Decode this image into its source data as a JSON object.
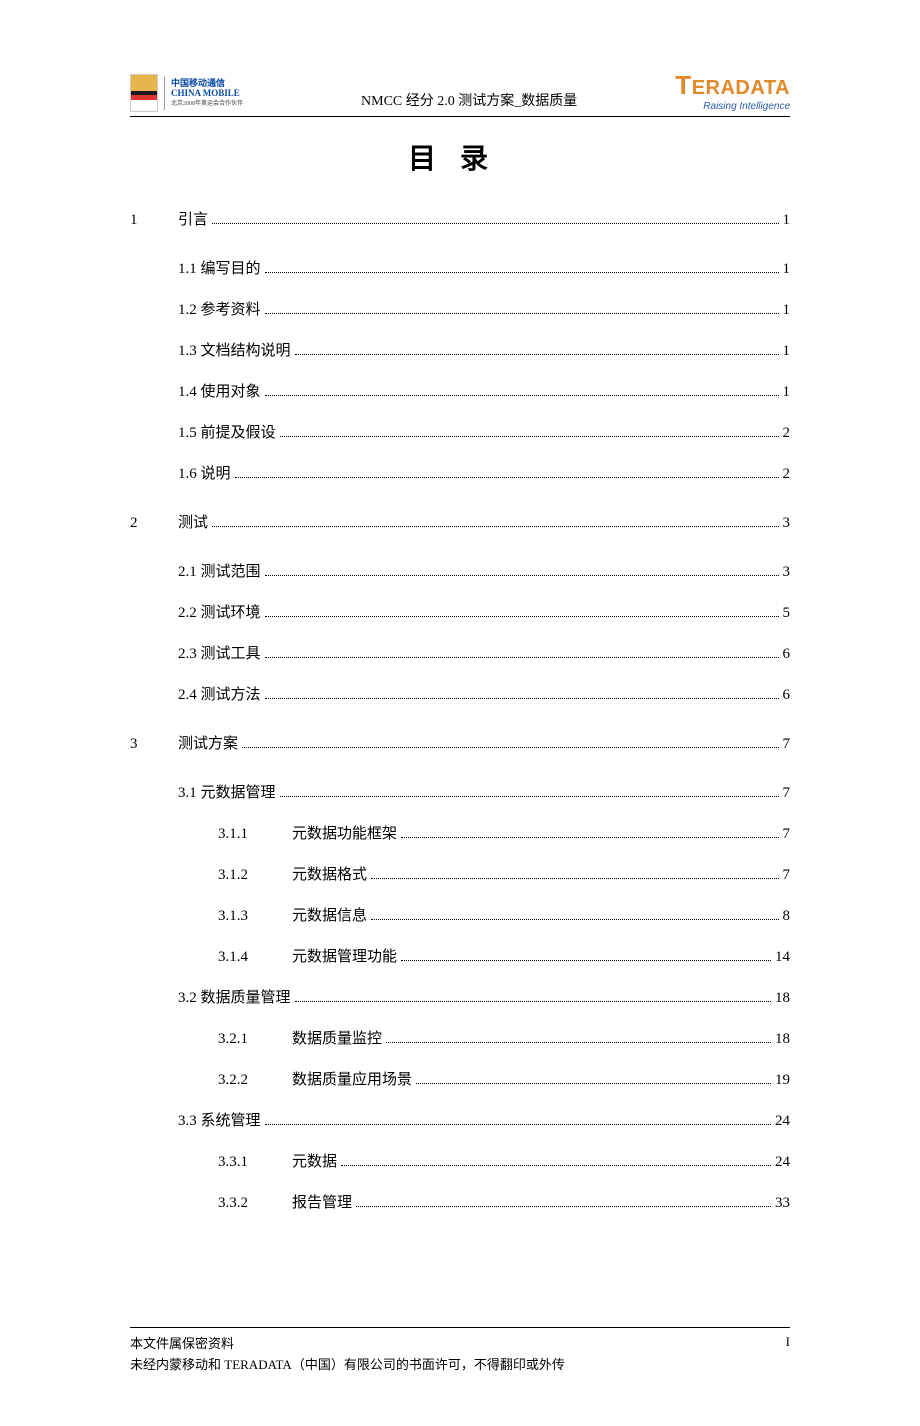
{
  "header": {
    "cmcc_cn": "中国移动通信",
    "cmcc_en": "CHINA MOBILE",
    "cmcc_sub": "北京2008年奥运会合作伙伴",
    "title": "NMCC 经分 2.0 测试方案_数据质量",
    "teradata": "ERADATA",
    "teradata_tag": "Raising Intelligence"
  },
  "toc_title": "目录",
  "toc": [
    {
      "level": 1,
      "num": "1",
      "label": "引言",
      "page": "1"
    },
    {
      "level": 2,
      "num": "1.1",
      "label": "编写目的",
      "page": "1"
    },
    {
      "level": 2,
      "num": "1.2",
      "label": "参考资料",
      "page": "1"
    },
    {
      "level": 2,
      "num": "1.3",
      "label": "文档结构说明",
      "page": "1"
    },
    {
      "level": 2,
      "num": "1.4",
      "label": "使用对象",
      "page": "1"
    },
    {
      "level": 2,
      "num": "1.5",
      "label": "前提及假设",
      "page": "2"
    },
    {
      "level": 2,
      "num": "1.6",
      "label": "说明",
      "page": "2"
    },
    {
      "level": 1,
      "num": "2",
      "label": "测试",
      "page": "3"
    },
    {
      "level": 2,
      "num": "2.1",
      "label": "测试范围",
      "page": "3"
    },
    {
      "level": 2,
      "num": "2.2",
      "label": "测试环境",
      "page": "5"
    },
    {
      "level": 2,
      "num": "2.3",
      "label": "测试工具",
      "page": "6"
    },
    {
      "level": 2,
      "num": "2.4",
      "label": "测试方法",
      "page": "6"
    },
    {
      "level": 1,
      "num": "3",
      "label": "测试方案",
      "page": "7"
    },
    {
      "level": 2,
      "num": "3.1",
      "label": "元数据管理",
      "page": "7"
    },
    {
      "level": 3,
      "num": "3.1.1",
      "label": "元数据功能框架",
      "page": "7"
    },
    {
      "level": 3,
      "num": "3.1.2",
      "label": "元数据格式",
      "page": "7"
    },
    {
      "level": 3,
      "num": "3.1.3",
      "label": "元数据信息",
      "page": "8"
    },
    {
      "level": 3,
      "num": "3.1.4",
      "label": "元数据管理功能",
      "page": "14"
    },
    {
      "level": 2,
      "num": "3.2",
      "label": "数据质量管理",
      "page": "18"
    },
    {
      "level": 3,
      "num": "3.2.1",
      "label": "数据质量监控",
      "page": "18"
    },
    {
      "level": 3,
      "num": "3.2.2",
      "label": "数据质量应用场景",
      "page": "19"
    },
    {
      "level": 2,
      "num": "3.3",
      "label": "系统管理",
      "page": "24"
    },
    {
      "level": 3,
      "num": "3.3.1",
      "label": "元数据",
      "page": "24"
    },
    {
      "level": 3,
      "num": "3.3.2",
      "label": "报告管理",
      "page": "33"
    }
  ],
  "footer": {
    "line1": "本文件属保密资料",
    "line2": "未经内蒙移动和 TERADATA（中国）有限公司的书面许可，不得翻印或外传",
    "page": "I"
  }
}
